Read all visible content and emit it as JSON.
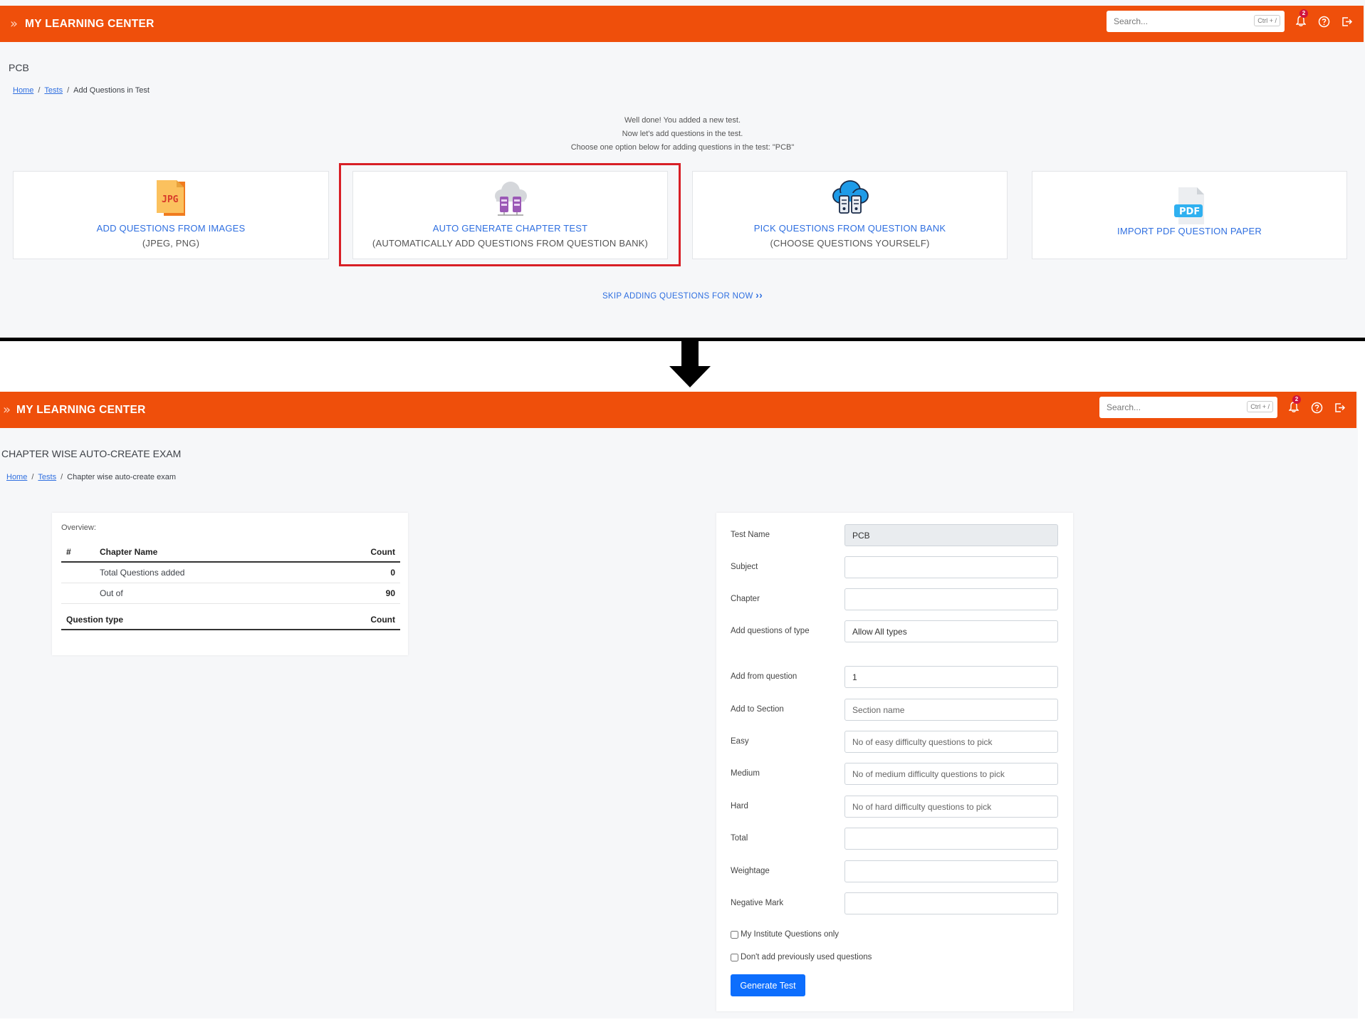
{
  "app": {
    "title": "MY LEARNING CENTER",
    "search_placeholder": "Search...",
    "search_shortcut": "Ctrl + /",
    "notification_count": "2",
    "brand_color": "#ef4f0b"
  },
  "screen1": {
    "page_title": "PCB",
    "breadcrumb": {
      "home": "Home",
      "tests": "Tests",
      "current": "Add Questions in Test"
    },
    "intro_lines": [
      "Well done! You added a new test.",
      "Now let's add questions in the test.",
      "Choose one option below for adding questions in the test: \"PCB\""
    ],
    "cards": [
      {
        "title": "ADD QUESTIONS FROM IMAGES",
        "subtitle": "(JPEG, PNG)",
        "icon": "jpg-file-icon",
        "icon_text": "JPG"
      },
      {
        "title": "AUTO GENERATE CHAPTER TEST",
        "subtitle": "(AUTOMATICALLY ADD QUESTIONS FROM QUESTION BANK)",
        "icon": "cloud-server-icon"
      },
      {
        "title": "PICK QUESTIONS FROM QUESTION BANK",
        "subtitle": "(CHOOSE QUESTIONS YOURSELF)",
        "icon": "cloud-database-icon"
      },
      {
        "title": "IMPORT PDF QUESTION PAPER",
        "subtitle": "",
        "icon": "pdf-file-icon",
        "icon_text": "PDF"
      }
    ],
    "highlighted_card": "AUTO GENERATE CHAPTER TEST",
    "skip_label": "SKIP ADDING QUESTIONS FOR NOW"
  },
  "screen2": {
    "page_title": "CHAPTER WISE AUTO-CREATE EXAM",
    "breadcrumb": {
      "home": "Home",
      "tests": "Tests",
      "current": "Chapter wise auto-create exam"
    },
    "overview": {
      "label": "Overview:",
      "headers": {
        "index": "#",
        "chapter": "Chapter Name",
        "count": "Count"
      },
      "rows": [
        {
          "label": "Total Questions added",
          "count": "0"
        },
        {
          "label": "Out of",
          "count": "90"
        }
      ],
      "qtype_header": {
        "label": "Question type",
        "count": "Count"
      }
    },
    "form": {
      "test_name": {
        "label": "Test Name",
        "value": "PCB"
      },
      "subject": {
        "label": "Subject",
        "value": ""
      },
      "chapter": {
        "label": "Chapter",
        "value": ""
      },
      "question_type": {
        "label": "Add questions of type",
        "value": "Allow All types"
      },
      "from_question": {
        "label": "Add from question",
        "value": "1"
      },
      "section": {
        "label": "Add to Section",
        "placeholder": "Section name"
      },
      "easy": {
        "label": "Easy",
        "placeholder": "No of easy difficulty questions to pick"
      },
      "medium": {
        "label": "Medium",
        "placeholder": "No of medium difficulty questions to pick"
      },
      "hard": {
        "label": "Hard",
        "placeholder": "No of hard difficulty questions to pick"
      },
      "total": {
        "label": "Total",
        "value": ""
      },
      "weightage": {
        "label": "Weightage",
        "value": ""
      },
      "negative_mark": {
        "label": "Negative Mark",
        "value": ""
      },
      "check_institute": "My Institute Questions only",
      "check_unused": "Don't add previously used questions",
      "submit_label": "Generate Test"
    }
  }
}
